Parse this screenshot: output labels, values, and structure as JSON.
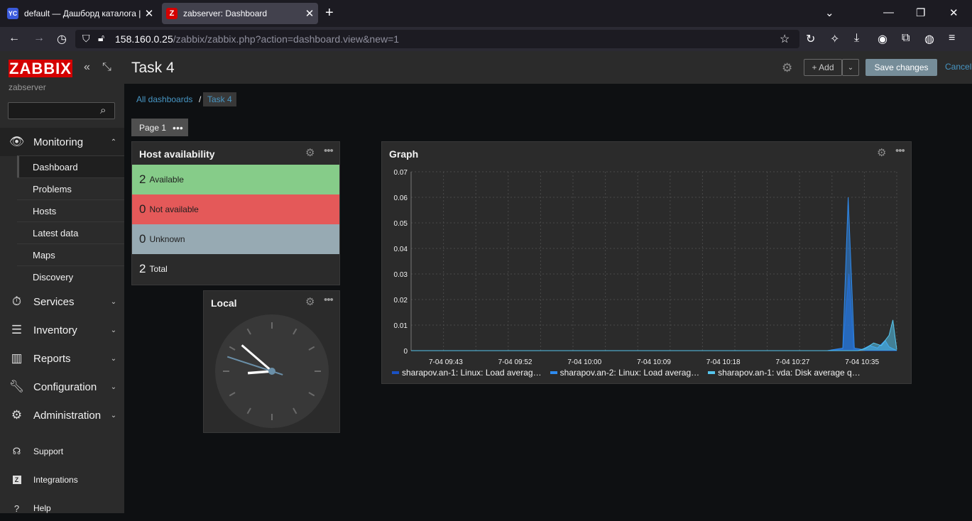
{
  "browser": {
    "tabs": [
      {
        "icon": "YC",
        "title": "default — Дашборд каталога |"
      },
      {
        "icon": "Z",
        "title": "zabserver: Dashboard"
      }
    ],
    "url_host": "158.160.0.25",
    "url_path": "/zabbix/zabbix.php?action=dashboard.view&new=1"
  },
  "sidebar": {
    "logo": "ZABBIX",
    "server": "zabserver",
    "search_value": "",
    "monitoring": {
      "label": "Monitoring",
      "items": [
        "Dashboard",
        "Problems",
        "Hosts",
        "Latest data",
        "Maps",
        "Discovery"
      ]
    },
    "sections": [
      "Services",
      "Inventory",
      "Reports",
      "Configuration",
      "Administration"
    ],
    "footer": [
      "Support",
      "Integrations",
      "Help"
    ]
  },
  "header": {
    "title": "Task 4",
    "add_label": "+ Add",
    "save_label": "Save changes",
    "cancel_label": "Cancel"
  },
  "breadcrumb": {
    "root": "All dashboards",
    "sep": "/",
    "current": "Task 4"
  },
  "page_tab": "Page 1",
  "host_availability": {
    "title": "Host availability",
    "rows": [
      {
        "count": "2",
        "label": "Available",
        "color": "#86cc89"
      },
      {
        "count": "0",
        "label": "Not available",
        "color": "#e45959"
      },
      {
        "count": "0",
        "label": "Unknown",
        "color": "#97aab3"
      },
      {
        "count": "2",
        "label": "Total",
        "color": "#2b2b2b"
      }
    ]
  },
  "clock": {
    "title": "Local",
    "hours": 8,
    "minutes": 51,
    "seconds": 48
  },
  "graph": {
    "title": "Graph",
    "legend": [
      {
        "label": "sharapov.an-1: Linux: Load averag…",
        "color": "#1a52c4"
      },
      {
        "label": "sharapov.an-2: Linux: Load averag…",
        "color": "#2e8bef"
      },
      {
        "label": "sharapov.an-1: vda: Disk average q…",
        "color": "#56c6ee"
      }
    ]
  },
  "chart_data": {
    "type": "area",
    "title": "Graph",
    "y_ticks": [
      "0.07",
      "0.06",
      "0.05",
      "0.04",
      "0.03",
      "0.02",
      "0.01",
      "0"
    ],
    "x_ticks": [
      "7-04 09:43",
      "7-04 09:52",
      "7-04 10:00",
      "7-04 10:09",
      "7-04 10:18",
      "7-04 10:27",
      "7-04 10:35"
    ],
    "ylim": [
      0,
      0.07
    ],
    "x_range_minutes": [
      0,
      63
    ],
    "series": [
      {
        "name": "sharapov.an-1: Linux: Load averag…",
        "color": "#1a52c4",
        "points": [
          [
            0,
            0
          ],
          [
            54,
            0
          ],
          [
            56,
            0.0005
          ],
          [
            56.8,
            0.03
          ],
          [
            57.4,
            0.0005
          ],
          [
            59,
            0
          ],
          [
            63,
            0
          ]
        ]
      },
      {
        "name": "sharapov.an-2: Linux: Load averag…",
        "color": "#2e8bef",
        "points": [
          [
            0,
            0
          ],
          [
            54,
            0
          ],
          [
            56,
            0.001
          ],
          [
            56.7,
            0.06
          ],
          [
            57.5,
            0.001
          ],
          [
            58.5,
            0.0005
          ],
          [
            59.5,
            0.002
          ],
          [
            60.5,
            0.001
          ],
          [
            61.5,
            0.004
          ],
          [
            62,
            0.0015
          ],
          [
            63,
            0
          ]
        ]
      },
      {
        "name": "sharapov.an-1: vda: Disk average q…",
        "color": "#56c6ee",
        "points": [
          [
            0,
            0
          ],
          [
            58,
            0
          ],
          [
            59,
            0.001
          ],
          [
            60,
            0.003
          ],
          [
            61,
            0.002
          ],
          [
            62,
            0.006
          ],
          [
            62.5,
            0.012
          ],
          [
            62.8,
            0.005
          ],
          [
            63,
            0.0005
          ]
        ]
      }
    ],
    "grid": true,
    "legend_position": "bottom"
  }
}
